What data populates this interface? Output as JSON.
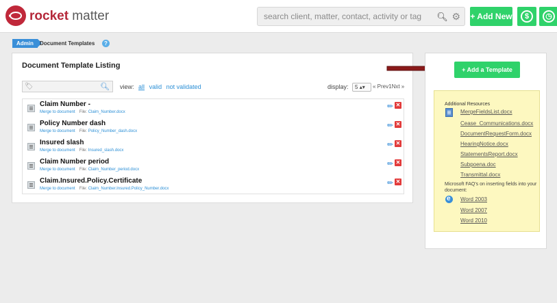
{
  "header": {
    "brand_bold": "rocket",
    "brand_light": " matter",
    "search_placeholder": "search client, matter, contact, activity or tag",
    "add_new_label": "+ Add New",
    "billing_symbol": "$",
    "timer_symbol": "◷"
  },
  "breadcrumb": {
    "admin": "Admin",
    "current": "Document Templates",
    "help": "?"
  },
  "listing": {
    "title": "Document Template Listing",
    "view_label": "view:",
    "filters": [
      "all",
      "valid",
      "not validated"
    ],
    "display_label": "display:",
    "display_value": "5",
    "pager": "« Prev1Nxt »",
    "rows": [
      {
        "name": "Claim Number -",
        "merge": "Merge to document",
        "file_label": "File:",
        "file": "Claim_Number.docx"
      },
      {
        "name": "Policy Number dash",
        "merge": "Merge to document",
        "file_label": "File:",
        "file": "Policy_Number_dash.docx"
      },
      {
        "name": "Insured slash",
        "merge": "Merge to document",
        "file_label": "File:",
        "file": "Insured_slash.docx"
      },
      {
        "name": "Claim Number period",
        "merge": "Merge to document",
        "file_label": "File:",
        "file": "Claim_Number_period.docx"
      },
      {
        "name": "Claim.Insured.Policy.Certificate",
        "merge": "Merge to document",
        "file_label": "File:",
        "file": "Claim_Number.Insured.Policy_Number.docx"
      }
    ]
  },
  "sidebar": {
    "add_template_label": "+ Add a Template",
    "resources_title": "Additional Resources",
    "resources": [
      "MergeFieldsList.docx",
      "Cease_Communications.docx",
      "DocumentRequestForm.docx",
      "HearingNotice.docx",
      "StatementsReport.docx",
      "Subpoena.doc",
      "Transmittal.docx"
    ],
    "ms_faq": "Microsoft FAQ's on inserting fields into your document:",
    "word_links": [
      "Word 2003",
      "Word 2007",
      "Word 2010"
    ]
  },
  "colors": {
    "brand_red": "#c0283a",
    "accent_green": "#2fd26a",
    "link_blue": "#2b8fd6",
    "resource_bg": "#fdf8c0",
    "arrow_red": "#8b1a1a"
  }
}
